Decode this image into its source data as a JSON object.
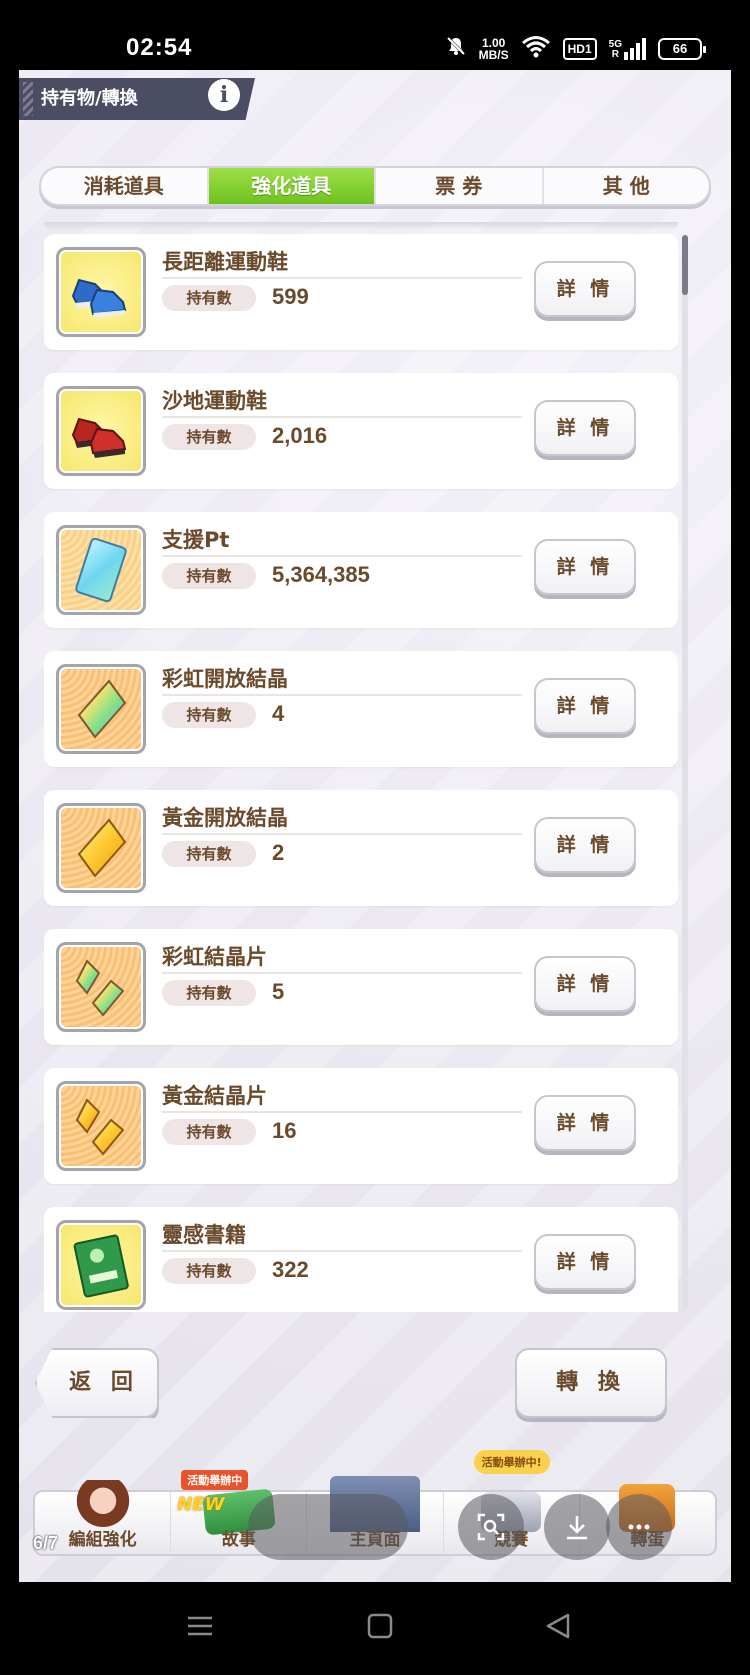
{
  "status_bar": {
    "time": "02:54",
    "network_speed_value": "1.00",
    "network_speed_unit": "MB/S",
    "hd_label": "HD1",
    "signal_label": "5G",
    "signal_sub": "R",
    "battery": "66"
  },
  "header": {
    "title": "持有物/轉換",
    "info_icon": "i"
  },
  "tabs": [
    {
      "label": "消耗道具",
      "active": false
    },
    {
      "label": "強化道具",
      "active": true
    },
    {
      "label": "票 券",
      "active": false
    },
    {
      "label": "其 他",
      "active": false
    }
  ],
  "items": [
    {
      "name": "長距離運動鞋",
      "qty_label": "持有數",
      "qty": "599",
      "icon": "blue-shoes-icon",
      "detail": "詳 情"
    },
    {
      "name": "沙地運動鞋",
      "qty_label": "持有數",
      "qty": "2,016",
      "icon": "red-shoes-icon",
      "detail": "詳 情"
    },
    {
      "name": "支援Pt",
      "qty_label": "持有數",
      "qty": "5,364,385",
      "icon": "support-card-icon",
      "detail": "詳 情"
    },
    {
      "name": "彩虹開放結晶",
      "qty_label": "持有數",
      "qty": "4",
      "icon": "rainbow-crystal-icon",
      "detail": "詳 情"
    },
    {
      "name": "黃金開放結晶",
      "qty_label": "持有數",
      "qty": "2",
      "icon": "gold-crystal-icon",
      "detail": "詳 情"
    },
    {
      "name": "彩虹結晶片",
      "qty_label": "持有數",
      "qty": "5",
      "icon": "rainbow-shards-icon",
      "detail": "詳 情"
    },
    {
      "name": "黃金結晶片",
      "qty_label": "持有數",
      "qty": "16",
      "icon": "gold-shards-icon",
      "detail": "詳 情"
    },
    {
      "name": "靈感書籍",
      "qty_label": "持有數",
      "qty": "322",
      "icon": "inspiration-book-icon",
      "detail": "詳 情"
    }
  ],
  "footer": {
    "back_label": "返 回",
    "convert_label": "轉 換"
  },
  "game_nav": {
    "items": [
      {
        "label": "編組強化"
      },
      {
        "label": "故事",
        "badge": "活動舉辦中",
        "badge2": "NEW"
      },
      {
        "label": "主頁面"
      },
      {
        "label": "競賽",
        "badge": "活動舉辦中!"
      },
      {
        "label": "轉蛋"
      }
    ],
    "page_indicator": "6/7"
  },
  "colors": {
    "text_brown": "#6b4a2c",
    "tab_active": "#7ac72a",
    "header_bg": "#4b4d62"
  }
}
